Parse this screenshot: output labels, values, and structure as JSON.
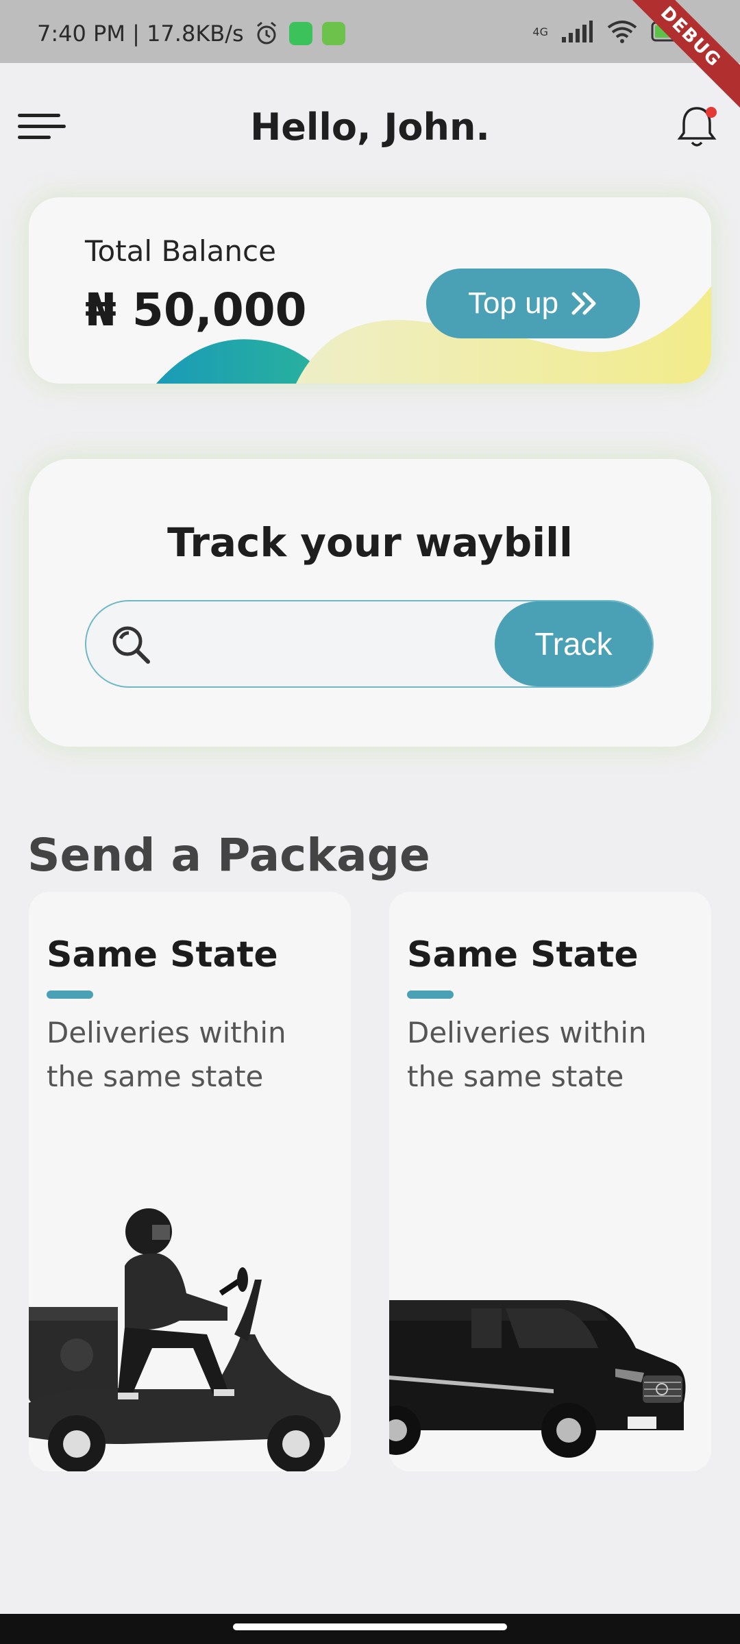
{
  "status_bar": {
    "time_speed": "7:40 PM | 17.8KB/s",
    "network": "4G",
    "icons": [
      "alarm-icon",
      "whatsapp-icon",
      "android-app-icon",
      "signal-icon",
      "wifi-icon",
      "battery-icon"
    ]
  },
  "debug_ribbon": "DEBUG",
  "header": {
    "greeting": "Hello, John.",
    "menu_icon": "hamburger-menu-icon",
    "notification_icon": "bell-icon"
  },
  "balance": {
    "label": "Total Balance",
    "amount": "₦ 50,000",
    "topup_label": "Top up",
    "topup_icon": "double-chevron-right-icon"
  },
  "tracker": {
    "title": "Track your waybill",
    "input_value": "",
    "button_label": "Track"
  },
  "send_package": {
    "title": "Send a Package",
    "cards": [
      {
        "title": "Same State",
        "description": "Deliveries within the same state",
        "illustration": "scooter-rider"
      },
      {
        "title": "Same State",
        "description": "Deliveries within the same state",
        "illustration": "delivery-van"
      }
    ]
  },
  "colors": {
    "accent": "#4aa0b5",
    "background": "#efeff1",
    "card": "#f7f7f8",
    "notification_dot": "#e53935"
  }
}
